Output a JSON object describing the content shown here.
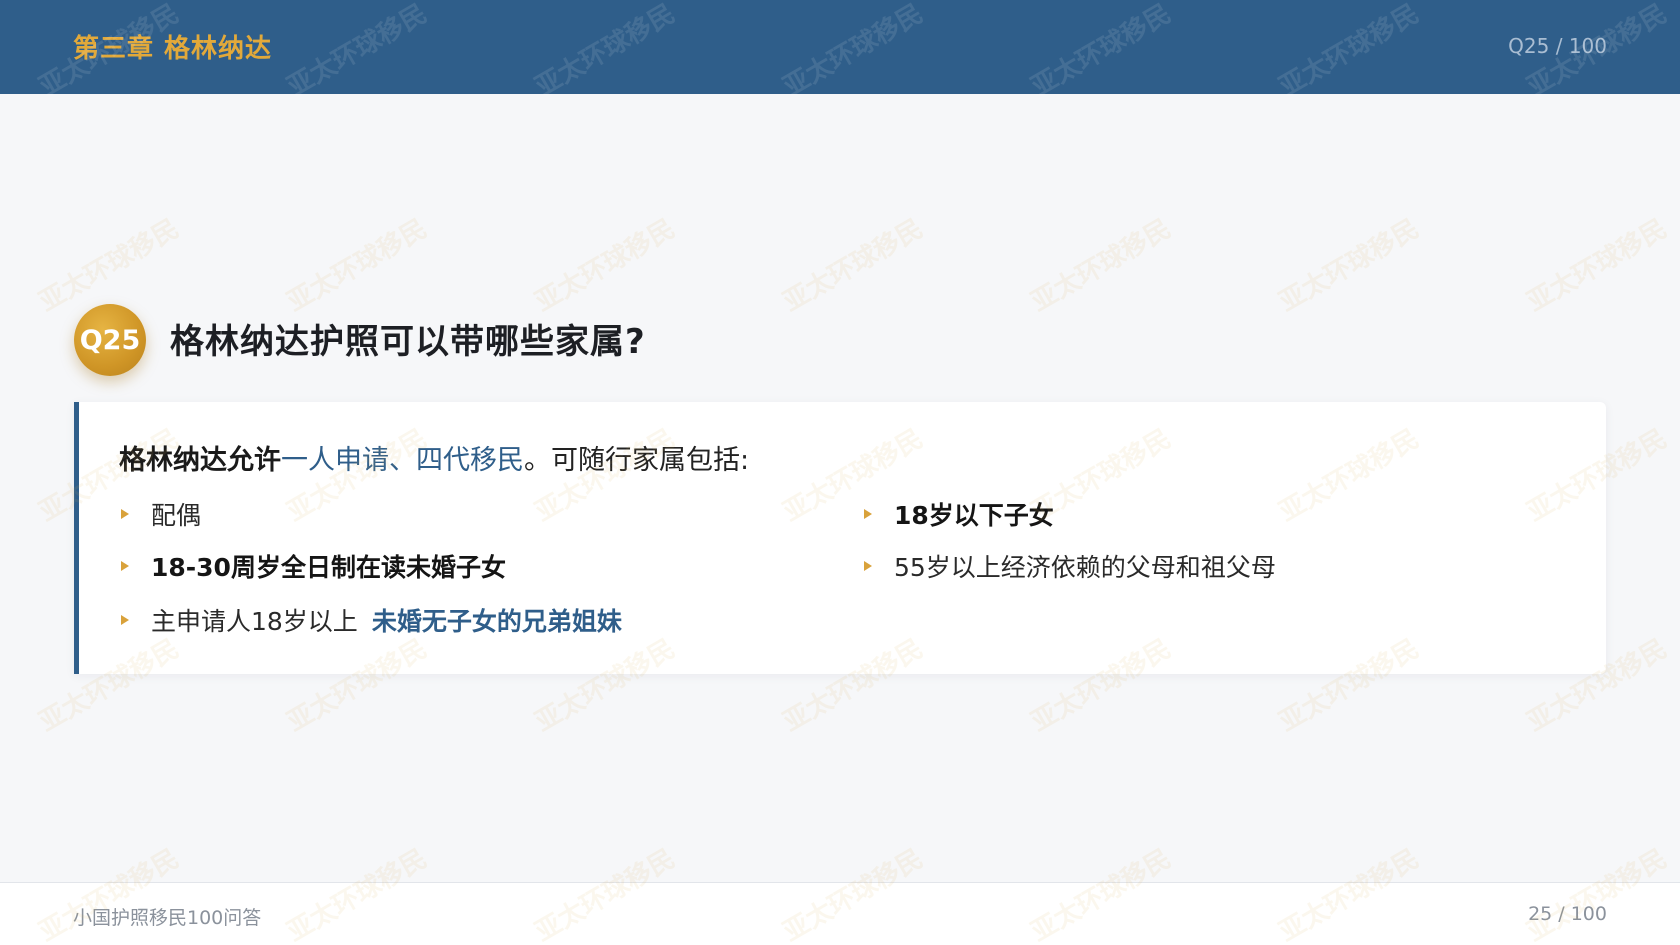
{
  "header": {
    "chapter": "第三章  格林纳达",
    "page_indicator": "Q25 / 100"
  },
  "question": {
    "badge": "Q25",
    "title": "格林纳达护照可以带哪些家属?"
  },
  "card": {
    "intro_bold": "格林纳达允许",
    "intro_highlight": "一人申请、四代移民",
    "intro_rest": "。可随行家属包括:",
    "items": [
      {
        "text": "配偶"
      },
      {
        "text": "18-30周岁全日制在读未婚子女"
      },
      {
        "text": "主申请人18岁以上",
        "highlight": "未婚无子女的兄弟姐妹"
      },
      {
        "text": "18岁以下子女"
      },
      {
        "text": "55岁以上经济依赖的父母和祖父母"
      }
    ]
  },
  "footer": {
    "left": "小国护照移民100问答",
    "right": "25 / 100"
  },
  "watermark": {
    "text": "亚太环球移民"
  },
  "colors": {
    "header_bg": "#2f5e8a",
    "accent_gold": "#d9a23b",
    "accent_blue": "#2f5e8a"
  }
}
